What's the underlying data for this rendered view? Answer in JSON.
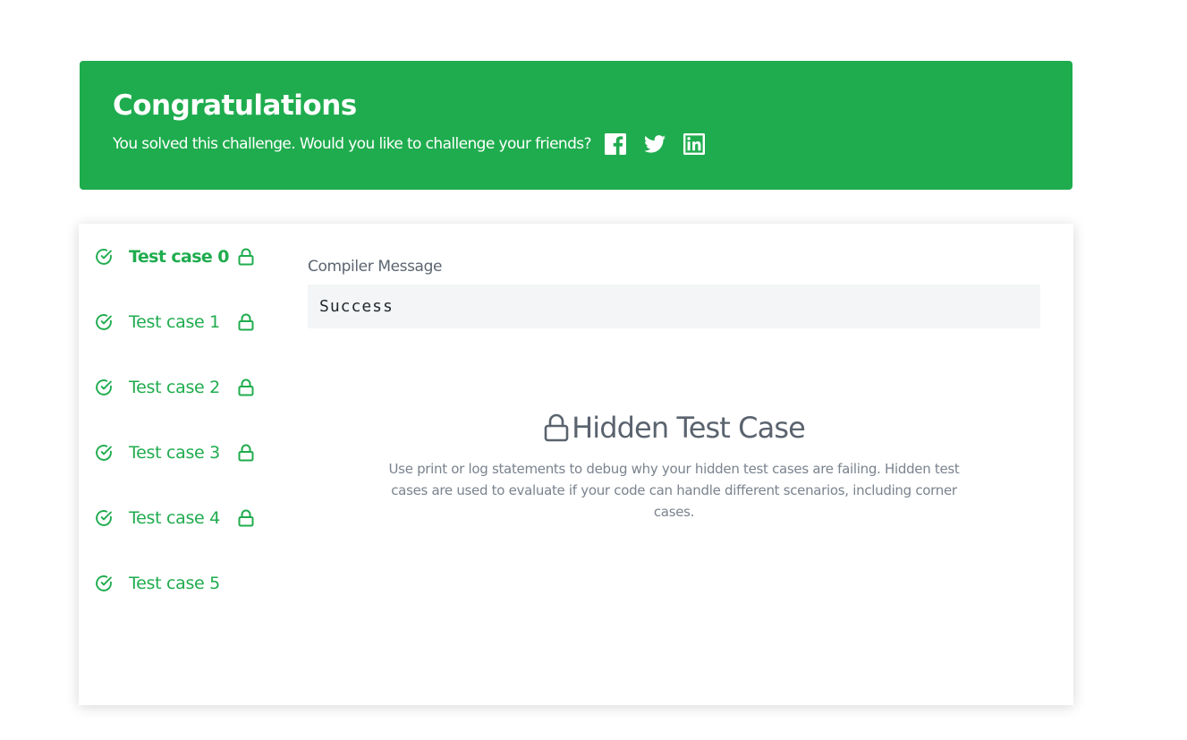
{
  "banner": {
    "title": "Congratulations",
    "subtitle": "You solved this challenge. Would you like to challenge your friends?",
    "share_icons": [
      "facebook-icon",
      "twitter-icon",
      "linkedin-icon"
    ],
    "background_color": "#1fac4e"
  },
  "test_cases": [
    {
      "label": "Test case 0",
      "status": "passed",
      "locked": true,
      "active": true
    },
    {
      "label": "Test case 1",
      "status": "passed",
      "locked": true,
      "active": false
    },
    {
      "label": "Test case 2",
      "status": "passed",
      "locked": true,
      "active": false
    },
    {
      "label": "Test case 3",
      "status": "passed",
      "locked": true,
      "active": false
    },
    {
      "label": "Test case 4",
      "status": "passed",
      "locked": true,
      "active": false
    },
    {
      "label": "Test case 5",
      "status": "passed",
      "locked": false,
      "active": false
    }
  ],
  "compiler": {
    "label": "Compiler Message",
    "message": "Success"
  },
  "hidden": {
    "icon": "lock-icon",
    "title": "Hidden Test Case",
    "description": "Use print or log statements to debug why your hidden test cases are failing. Hidden test cases are used to evaluate if your code can handle different scenarios, including corner cases."
  },
  "colors": {
    "success": "#1fac4e",
    "heading": "#5a636e",
    "muted": "#7a838e",
    "code_bg": "#f3f5f6"
  }
}
